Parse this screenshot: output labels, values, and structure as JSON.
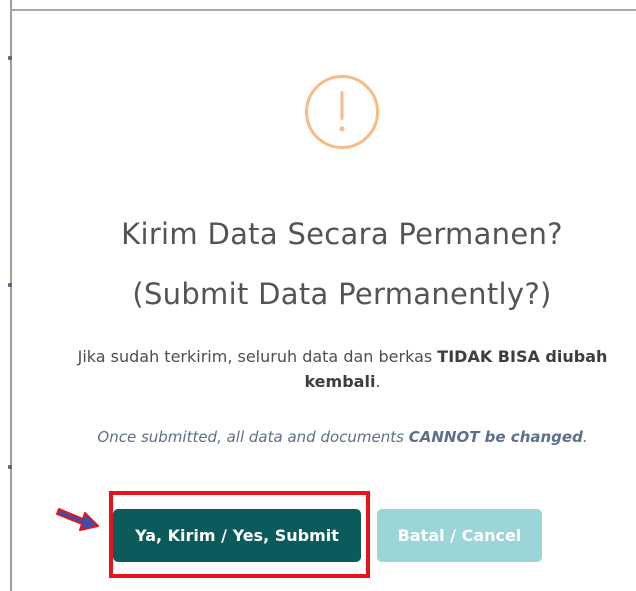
{
  "dialog": {
    "icon": "exclamation-icon",
    "title_id": "Kirim Data Secara Permanen?",
    "title_en": "(Submit Data Permanently?)",
    "message_id": {
      "prefix": "Jika sudah terkirim, seluruh data dan berkas ",
      "emphasis": "TIDAK BISA diubah kembali",
      "suffix": "."
    },
    "message_en": {
      "prefix": "Once submitted, all data and documents ",
      "emphasis": "CANNOT be changed",
      "suffix": "."
    },
    "confirm_label": "Ya, Kirim / Yes, Submit",
    "cancel_label": "Batal / Cancel"
  },
  "annotations": {
    "highlight": "red-highlight-box",
    "pointer": "red-arrow-icon"
  },
  "colors": {
    "icon_ring": "#f8bb86",
    "confirm_bg": "#0b5a5c",
    "cancel_bg": "#9bd5d8",
    "highlight": "#e6141c",
    "arrow_fill": "#3a4fa8",
    "arrow_outline": "#e6141c"
  }
}
